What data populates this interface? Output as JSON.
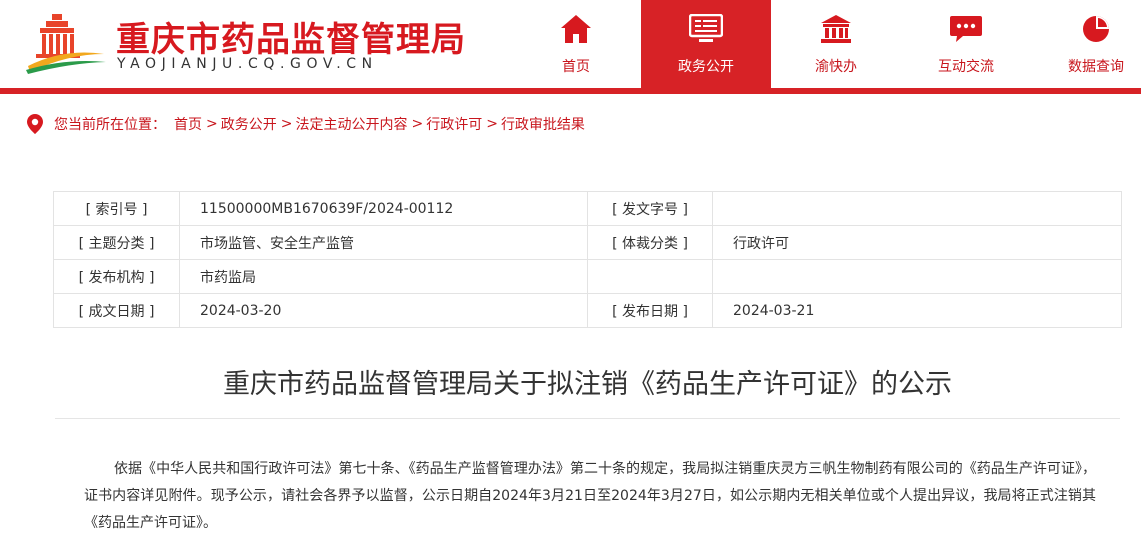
{
  "header": {
    "title": "重庆市药品监督管理局",
    "domain": "YAOJIANJU.CQ.GOV.CN",
    "logo_icon": "building-logo-icon"
  },
  "nav": [
    {
      "label": "首页",
      "icon": "home-icon",
      "active": false
    },
    {
      "label": "政务公开",
      "icon": "monitor-icon",
      "active": true
    },
    {
      "label": "渝快办",
      "icon": "government-building-icon",
      "active": false
    },
    {
      "label": "互动交流",
      "icon": "chat-icon",
      "active": false
    },
    {
      "label": "数据查询",
      "icon": "pie-chart-icon",
      "active": false
    }
  ],
  "breadcrumb": {
    "label": "您当前所在位置：",
    "items": [
      "首页",
      "政务公开",
      "法定主动公开内容",
      "行政许可",
      "行政审批结果"
    ],
    "separator": ">"
  },
  "meta": {
    "index_no_label": "[ 索引号 ]",
    "index_no": "11500000MB1670639F/2024-00112",
    "doc_no_label": "[ 发文字号 ]",
    "doc_no": "",
    "topic_label": "[ 主题分类 ]",
    "topic": "市场监管、安全生产监管",
    "genre_label": "[ 体裁分类 ]",
    "genre": "行政许可",
    "issuer_label": "[ 发布机构 ]",
    "issuer": "市药监局",
    "created_label": "[ 成文日期 ]",
    "created": "2024-03-20",
    "published_label": "[ 发布日期 ]",
    "published": "2024-03-21"
  },
  "article": {
    "title": "重庆市药品监督管理局关于拟注销《药品生产许可证》的公示",
    "body": "依据《中华人民共和国行政许可法》第七十条、《药品生产监督管理办法》第二十条的规定，我局拟注销重庆灵方三帆生物制药有限公司的《药品生产许可证》，证书内容详见附件。现予公示，请社会各界予以监督，公示日期自2024年3月21日至2024年3月27日，如公示期内无相关单位或个人提出异议，我局将正式注销其《药品生产许可证》。"
  },
  "colors": {
    "brand_red": "#d72226",
    "text": "#333333",
    "border": "#e3e3e3"
  }
}
